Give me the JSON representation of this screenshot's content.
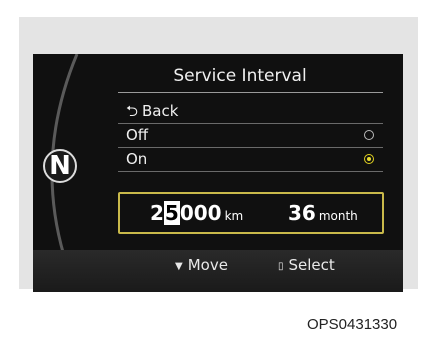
{
  "display": {
    "gear_indicator": "N",
    "title": "Service Interval",
    "menu": {
      "back_label": "Back",
      "back_icon": "back-arrow-icon",
      "items": [
        {
          "label": "Off",
          "selected": false
        },
        {
          "label": "On",
          "selected": true
        }
      ]
    },
    "interval": {
      "distance_prefix": "2",
      "distance_selected_digit": "5",
      "distance_suffix": "000",
      "distance_unit": "km",
      "months": "36",
      "months_unit": "month"
    },
    "footer": {
      "move_label": "Move",
      "move_icon": "down-triangle-icon",
      "select_label": "Select",
      "select_icon": "select-button-icon"
    }
  },
  "caption": "OPS0431330"
}
